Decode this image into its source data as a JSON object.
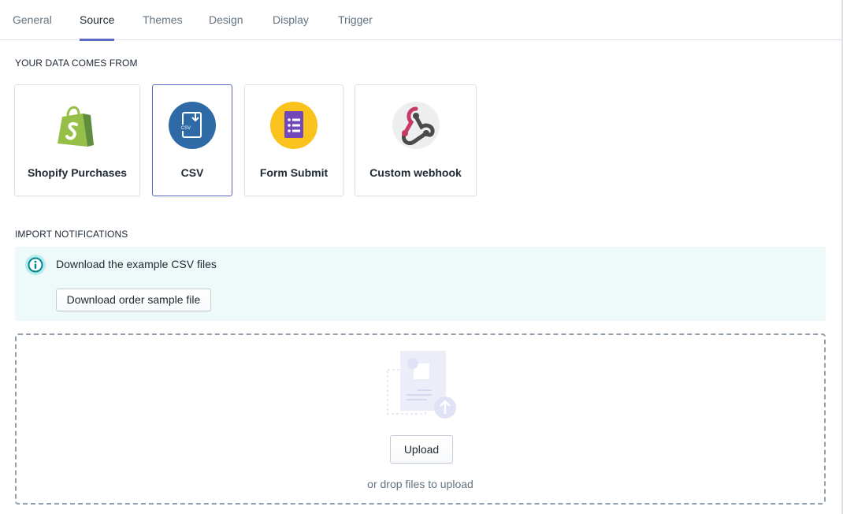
{
  "tabs": [
    {
      "label": "General",
      "active": false
    },
    {
      "label": "Source",
      "active": true
    },
    {
      "label": "Themes",
      "active": false
    },
    {
      "label": "Design",
      "active": false
    },
    {
      "label": "Display",
      "active": false
    },
    {
      "label": "Trigger",
      "active": false
    }
  ],
  "source": {
    "heading": "YOUR DATA COMES FROM",
    "cards": [
      {
        "label": "Shopify Purchases",
        "icon": "shopify-bag-icon",
        "selected": false
      },
      {
        "label": "CSV",
        "icon": "csv-file-icon",
        "selected": true
      },
      {
        "label": "Form Submit",
        "icon": "google-forms-icon",
        "selected": false
      },
      {
        "label": "Custom webhook",
        "icon": "webhook-icon",
        "selected": false
      }
    ]
  },
  "import": {
    "heading": "IMPORT NOTIFICATIONS",
    "banner_text": "Download the example CSV files",
    "download_button": "Download order sample file",
    "upload_button": "Upload",
    "drop_hint": "or drop files to upload"
  },
  "colors": {
    "accent": "#5c6ac4",
    "banner_bg": "#eef9f9",
    "shopify_green": "#95bf47",
    "csv_blue": "#2d6aa6",
    "forms_purple": "#7248b9",
    "forms_yellow": "#f9c21c",
    "webhook_red": "#c73a63"
  }
}
